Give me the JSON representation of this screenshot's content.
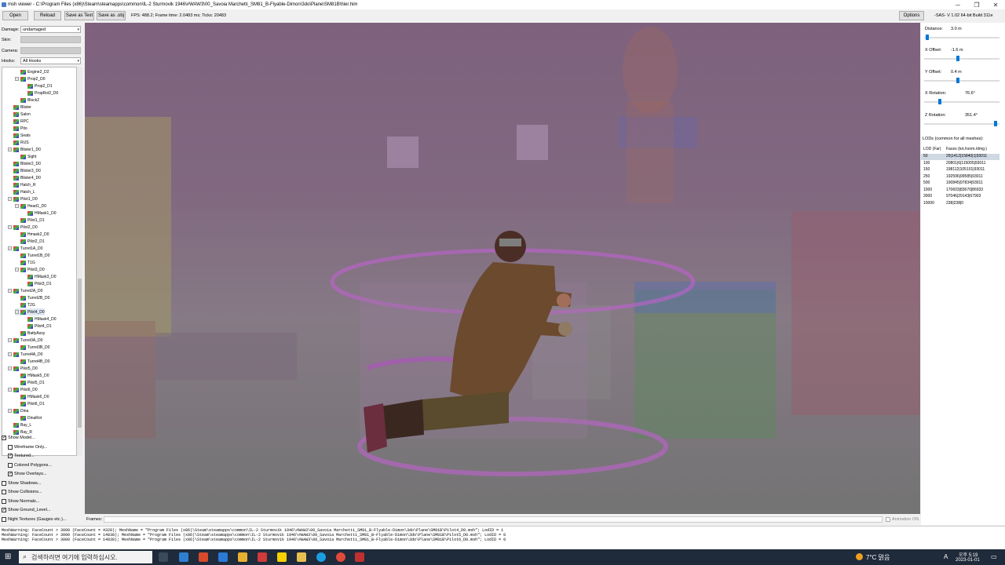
{
  "window": {
    "title": "msh viewer - C:\\Program Files (x86)\\Steam\\steamapps\\common\\IL-2 Sturmovik 1946\\#WAW3\\00_Savoia Marchetti_SM81_B-Flyable-Dimon\\3do\\Plane\\SM81B\\hier.him",
    "min": "─",
    "max": "❐",
    "close": "✕"
  },
  "toolbar": {
    "open": "Open",
    "reload": "Reload",
    "save_text": "Save as Text",
    "save_obj": "Save as .obj",
    "fps": "FPS: 488.2; Frame time: 2.0483 ms; Ticks: 20483",
    "options": "Options",
    "build": "-SAS- V 1.02  64-bit  Build 311e"
  },
  "left": {
    "damage_label": "Damage:",
    "damage_value": "undamaged",
    "skin_label": "Skin:",
    "camera_label": "Camera:",
    "hooks_label": "Hooks:",
    "hooks_value": "All Hooks",
    "tree": [
      {
        "t": "Engine2_D2",
        "d": 2,
        "e": false
      },
      {
        "t": "Prop2_D0",
        "d": 2,
        "e": true
      },
      {
        "t": "Prop2_D1",
        "d": 3,
        "e": false
      },
      {
        "t": "PropRot2_D0",
        "d": 3,
        "e": false
      },
      {
        "t": "Block2",
        "d": 2,
        "e": false
      },
      {
        "t": "Blister",
        "d": 1,
        "e": false
      },
      {
        "t": "Salon",
        "d": 1,
        "e": false
      },
      {
        "t": "RPC",
        "d": 1,
        "e": false
      },
      {
        "t": "Pito",
        "d": 1,
        "e": false
      },
      {
        "t": "Seats",
        "d": 1,
        "e": false
      },
      {
        "t": "RUS",
        "d": 1,
        "e": false
      },
      {
        "t": "Blister1_D0",
        "d": 1,
        "e": true
      },
      {
        "t": "Sight",
        "d": 2,
        "e": false
      },
      {
        "t": "Blister2_D0",
        "d": 1,
        "e": false
      },
      {
        "t": "Blister3_D0",
        "d": 1,
        "e": false
      },
      {
        "t": "Blister4_D0",
        "d": 1,
        "e": false
      },
      {
        "t": "Hatch_R",
        "d": 1,
        "e": false
      },
      {
        "t": "Hatch_L",
        "d": 1,
        "e": false
      },
      {
        "t": "Pilot1_D0",
        "d": 1,
        "e": true
      },
      {
        "t": "Head1_D0",
        "d": 2,
        "e": true
      },
      {
        "t": "HMask1_D0",
        "d": 3,
        "e": false
      },
      {
        "t": "Pilot1_D1",
        "d": 2,
        "e": false
      },
      {
        "t": "Pilot2_D0",
        "d": 1,
        "e": true
      },
      {
        "t": "Hmask2_D0",
        "d": 2,
        "e": false
      },
      {
        "t": "Pilot2_D1",
        "d": 2,
        "e": false
      },
      {
        "t": "Turret1A_D0",
        "d": 1,
        "e": true
      },
      {
        "t": "Turret1B_D0",
        "d": 2,
        "e": false
      },
      {
        "t": "T1G",
        "d": 2,
        "e": false
      },
      {
        "t": "Pilot3_D0",
        "d": 2,
        "e": true
      },
      {
        "t": "HMask3_D0",
        "d": 3,
        "e": false
      },
      {
        "t": "Pilot3_D1",
        "d": 3,
        "e": false
      },
      {
        "t": "Turret2A_D0",
        "d": 1,
        "e": true
      },
      {
        "t": "Turret2B_D0",
        "d": 2,
        "e": false
      },
      {
        "t": "T2G",
        "d": 2,
        "e": false
      },
      {
        "t": "Pilot4_D0",
        "d": 2,
        "e": true,
        "h": true
      },
      {
        "t": "HMask4_D0",
        "d": 3,
        "e": false
      },
      {
        "t": "Pilot4_D1",
        "d": 3,
        "e": false
      },
      {
        "t": "BattyAssy",
        "d": 2,
        "e": false
      },
      {
        "t": "Turret3A_D0",
        "d": 1,
        "e": true
      },
      {
        "t": "Turret3B_D0",
        "d": 2,
        "e": false
      },
      {
        "t": "Turret4A_D0",
        "d": 1,
        "e": true
      },
      {
        "t": "Turret4B_D0",
        "d": 2,
        "e": false
      },
      {
        "t": "Pilot5_D0",
        "d": 1,
        "e": true
      },
      {
        "t": "HMask5_D0",
        "d": 2,
        "e": false
      },
      {
        "t": "Pilot5_D1",
        "d": 2,
        "e": false
      },
      {
        "t": "Pilot6_D0",
        "d": 1,
        "e": true
      },
      {
        "t": "HMask6_D0",
        "d": 2,
        "e": false
      },
      {
        "t": "Pilot6_D1",
        "d": 2,
        "e": false
      },
      {
        "t": "Dina",
        "d": 1,
        "e": true
      },
      {
        "t": "DinaRot",
        "d": 2,
        "e": false
      },
      {
        "t": "Bay_L",
        "d": 1,
        "e": false
      },
      {
        "t": "Bay_R",
        "d": 1,
        "e": false
      }
    ],
    "checks": [
      {
        "label": "Show Model...",
        "checked": true,
        "indent": 0
      },
      {
        "label": "Wireframe Only...",
        "checked": false,
        "indent": 1
      },
      {
        "label": "Textured...",
        "checked": true,
        "indent": 1
      },
      {
        "label": "Colored Polygons...",
        "checked": false,
        "indent": 1
      },
      {
        "label": "Show Overlays...",
        "checked": true,
        "indent": 1
      },
      {
        "label": "Show Shadows...",
        "checked": false,
        "indent": 0
      },
      {
        "label": "Show Collisions...",
        "checked": false,
        "indent": 0
      },
      {
        "label": "Show Normals...",
        "checked": false,
        "indent": 0
      },
      {
        "label": "Show Ground_Level...",
        "checked": true,
        "indent": 0
      },
      {
        "label": "Night Textures (Gauges etc.)...",
        "checked": false,
        "indent": 0
      }
    ]
  },
  "frames": {
    "label": "Frames:",
    "animation": "Animation ON"
  },
  "right": {
    "distance_label": "Distance:",
    "distance_value": "3.0 m",
    "distance_pos": 0.02,
    "xoff_label": "X Offset:",
    "xoff_value": "-1.6 m",
    "xoff_pos": 0.45,
    "yoff_label": "Y Offset:",
    "yoff_value": "0.4 m",
    "yoff_pos": 0.45,
    "xrot_label": "X Rotation:",
    "xrot_value": "76.6°",
    "xrot_pos": 0.2,
    "zrot_label": "Z Rotation:",
    "zrot_value": "351.4°",
    "zrot_pos": 0.97,
    "lod_title": "LODs (common for all meshes):",
    "lod_h1": "LOD (Far)",
    "lod_h2": "Faces (tot./norm./dmg.)",
    "lods": [
      [
        "50",
        "29|1412|15840|1|93011"
      ],
      [
        "100",
        "20801|6|115005|93011"
      ],
      [
        "150",
        "198112|105101|93011"
      ],
      [
        "250",
        "192596|99585|93011"
      ],
      [
        "500",
        "190845|97834|93011"
      ],
      [
        "1000",
        "170603|83670|86933"
      ],
      [
        "3000",
        "97046|29143|67903"
      ],
      [
        "10000",
        "238|238|0"
      ]
    ]
  },
  "log": [
    "MeshWarning: FaceCount > 3000 (FaceCount = 4328); MeshName = \"Program Files (x86)\\Steam\\steamapps\\common\\IL-2 Sturmovik 1946\\#WAW3\\00_Savoia Marchetti_SM81_B-Flyable-Dimon\\3do\\Plane\\SM81B\\Pilot4_D0.msh\"; LodID = 1",
    "MeshWarning: FaceCount > 3000 (FaceCount = 14838); MeshName = \"Program Files (x86)\\Steam\\steamapps\\common\\IL-2 Sturmovik 1946\\#WAW3\\00_Savoia Marchetti_SM81_B-Flyable-Dimon\\3do\\Plane\\SM81B\\Pilot5_D0.msh\"; LodID = 0",
    "MeshWarning: FaceCount > 3000 (FaceCount = 14838); MeshName = \"Program Files (x86)\\Steam\\steamapps\\common\\IL-2 Sturmovik 1946\\#WAW3\\00_Savoia Marchetti_SM81_B-Flyable-Dimon\\3do\\Plane\\SM81B\\Pilot6_D0.msh\"; LodID = 0"
  ],
  "taskbar": {
    "search": "검색하려면 여기에 입력하십시오.",
    "weather": "7°C 맑음",
    "time": "오후 5:19",
    "date": "2023-01-01",
    "lang": "A"
  }
}
